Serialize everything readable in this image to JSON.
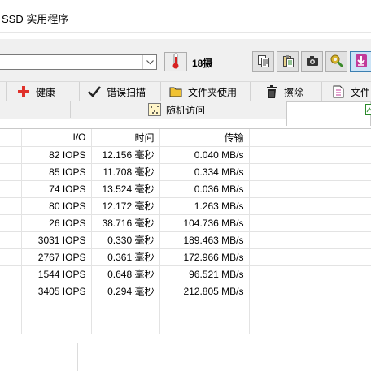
{
  "window": {
    "title": "SSD 实用程序"
  },
  "toolbar": {
    "temperature": "18摄",
    "buttons": [
      {
        "name": "copy-icon"
      },
      {
        "name": "clipboard-icon"
      },
      {
        "name": "camera-icon"
      },
      {
        "name": "tools-icon"
      },
      {
        "name": "download-arrow-icon"
      }
    ]
  },
  "tabs": {
    "health": "健康",
    "error_scan": "错误扫描",
    "file_usage": "文件夹使用",
    "erase": "擦除",
    "file_partial": "文件",
    "random_access": "随机访问"
  },
  "table": {
    "headers": {
      "io": "I/O",
      "time": "时间",
      "transfer": "传输"
    },
    "rows": [
      {
        "io": "82 IOPS",
        "time": "12.156 毫秒",
        "transfer": "0.040 MB/s"
      },
      {
        "io": "85 IOPS",
        "time": "11.708 毫秒",
        "transfer": "0.334 MB/s"
      },
      {
        "io": "74 IOPS",
        "time": "13.524 毫秒",
        "transfer": "0.036 MB/s"
      },
      {
        "io": "80 IOPS",
        "time": "12.172 毫秒",
        "transfer": "1.263 MB/s"
      },
      {
        "io": "26 IOPS",
        "time": "38.716 毫秒",
        "transfer": "104.736 MB/s"
      },
      {
        "io": "3031 IOPS",
        "time": "0.330 毫秒",
        "transfer": "189.463 MB/s"
      },
      {
        "io": "2767 IOPS",
        "time": "0.361 毫秒",
        "transfer": "172.966 MB/s"
      },
      {
        "io": "1544 IOPS",
        "time": "0.648 毫秒",
        "transfer": "96.521 MB/s"
      },
      {
        "io": "3405 IOPS",
        "time": "0.294 毫秒",
        "transfer": "212.805 MB/s"
      }
    ]
  },
  "colors": {
    "accent_pink": "#c23b9a",
    "health_red": "#e0312b",
    "folder_yellow": "#f1c232"
  }
}
